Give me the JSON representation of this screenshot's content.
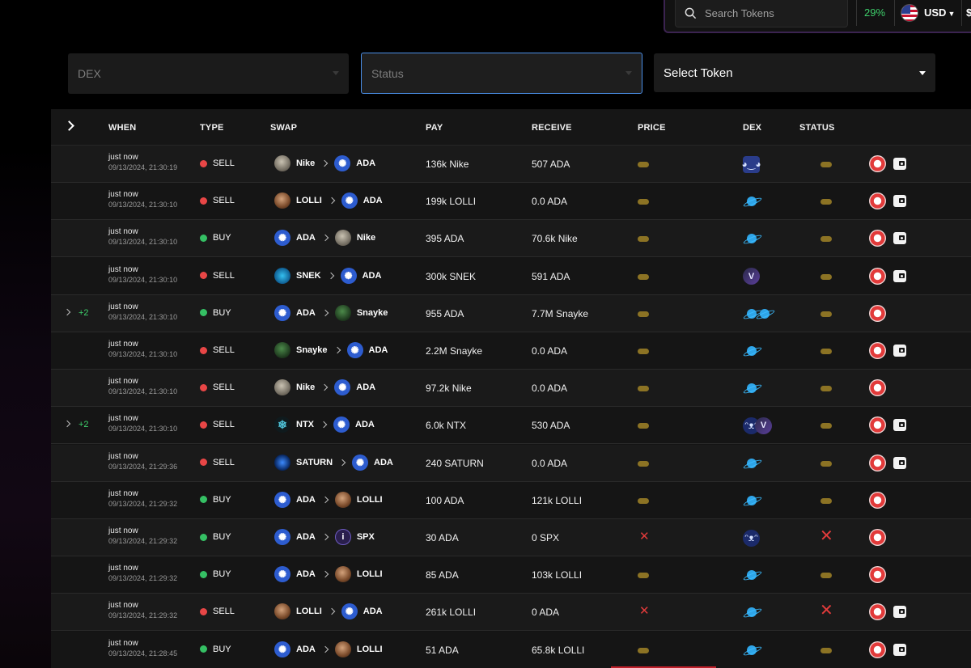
{
  "topbar": {
    "search_placeholder": "Search Tokens",
    "percent": "29%",
    "currency": "USD",
    "currency_symbol": "$"
  },
  "filters": {
    "dex_placeholder": "DEX",
    "status_placeholder": "Status",
    "token_label": "Select Token"
  },
  "table": {
    "headers": {
      "when": "WHEN",
      "type": "TYPE",
      "swap": "SWAP",
      "pay": "PAY",
      "receive": "RECEIVE",
      "price": "PRICE",
      "dex": "DEX",
      "status": "STATUS"
    },
    "rows": [
      {
        "when": "just now",
        "ts": "09/13/2024, 21:30:19",
        "more": "",
        "type": "SELL",
        "from": "Nike",
        "to": "ADA",
        "pay": "136k Nike",
        "receive": "507 ADA"
      },
      {
        "when": "just now",
        "ts": "09/13/2024, 21:30:10",
        "more": "",
        "type": "SELL",
        "from": "LOLLI",
        "to": "ADA",
        "pay": "199k LOLLI",
        "receive": "0.0 ADA"
      },
      {
        "when": "just now",
        "ts": "09/13/2024, 21:30:10",
        "more": "",
        "type": "BUY",
        "from": "ADA",
        "to": "Nike",
        "pay": "395 ADA",
        "receive": "70.6k Nike"
      },
      {
        "when": "just now",
        "ts": "09/13/2024, 21:30:10",
        "more": "",
        "type": "SELL",
        "from": "SNEK",
        "to": "ADA",
        "pay": "300k SNEK",
        "receive": "591 ADA"
      },
      {
        "when": "just now",
        "ts": "09/13/2024, 21:30:10",
        "more": "+2",
        "type": "BUY",
        "from": "ADA",
        "to": "Snayke",
        "pay": "955 ADA",
        "receive": "7.7M Snayke"
      },
      {
        "when": "just now",
        "ts": "09/13/2024, 21:30:10",
        "more": "",
        "type": "SELL",
        "from": "Snayke",
        "to": "ADA",
        "pay": "2.2M Snayke",
        "receive": "0.0 ADA"
      },
      {
        "when": "just now",
        "ts": "09/13/2024, 21:30:10",
        "more": "",
        "type": "SELL",
        "from": "Nike",
        "to": "ADA",
        "pay": "97.2k Nike",
        "receive": "0.0 ADA"
      },
      {
        "when": "just now",
        "ts": "09/13/2024, 21:30:10",
        "more": "+2",
        "type": "SELL",
        "from": "NTX",
        "to": "ADA",
        "pay": "6.0k NTX",
        "receive": "530 ADA"
      },
      {
        "when": "just now",
        "ts": "09/13/2024, 21:29:36",
        "more": "",
        "type": "SELL",
        "from": "SATURN",
        "to": "ADA",
        "pay": "240 SATURN",
        "receive": "0.0 ADA"
      },
      {
        "when": "just now",
        "ts": "09/13/2024, 21:29:32",
        "more": "",
        "type": "BUY",
        "from": "ADA",
        "to": "LOLLI",
        "pay": "100 ADA",
        "receive": "121k LOLLI"
      },
      {
        "when": "just now",
        "ts": "09/13/2024, 21:29:32",
        "more": "",
        "type": "BUY",
        "from": "ADA",
        "to": "SPX",
        "pay": "30 ADA",
        "receive": "0 SPX"
      },
      {
        "when": "just now",
        "ts": "09/13/2024, 21:29:32",
        "more": "",
        "type": "BUY",
        "from": "ADA",
        "to": "LOLLI",
        "pay": "85 ADA",
        "receive": "103k LOLLI"
      },
      {
        "when": "just now",
        "ts": "09/13/2024, 21:29:32",
        "more": "",
        "type": "SELL",
        "from": "LOLLI",
        "to": "ADA",
        "pay": "261k LOLLI",
        "receive": "0 ADA"
      },
      {
        "when": "just now",
        "ts": "09/13/2024, 21:28:45",
        "more": "",
        "type": "BUY",
        "from": "ADA",
        "to": "LOLLI",
        "pay": "51 ADA",
        "receive": "65.8k LOLLI"
      }
    ]
  },
  "colors": {
    "sell": "#e84646",
    "buy": "#35c064",
    "accent_focus": "#4b8fe8",
    "pending": "#8c7324",
    "failed": "#e23b3b"
  }
}
